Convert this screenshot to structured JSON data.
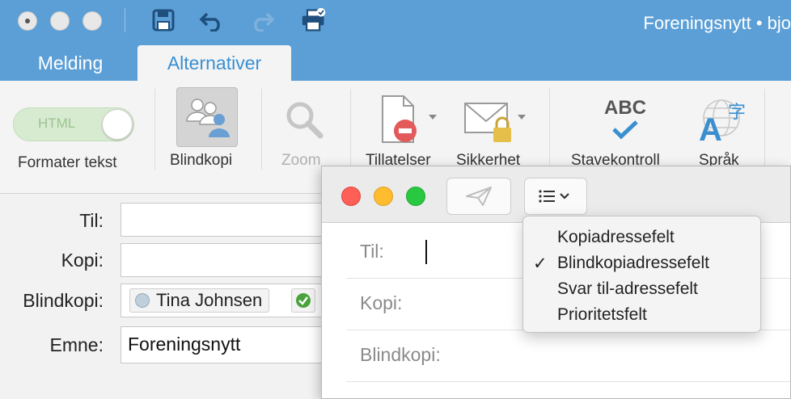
{
  "titlebar": {
    "window_title": "Foreningsnytt • bjo",
    "icons": [
      "close-dot-icon",
      "save-icon",
      "undo-icon",
      "redo-icon",
      "print-icon"
    ]
  },
  "tabs": [
    {
      "label": "Melding",
      "active": false
    },
    {
      "label": "Alternativer",
      "active": true
    }
  ],
  "ribbon": {
    "format_toggle": "HTML",
    "format_label": "Formater tekst",
    "bcc_label": "Blindkopi",
    "zoom_label": "Zoom",
    "permissions_label": "Tillatelser",
    "security_label": "Sikkerhet",
    "spelling_label": "Stavekontroll",
    "spelling_icon_text": "ABC",
    "language_label": "Språk"
  },
  "form": {
    "to_label": "Til:",
    "cc_label": "Kopi:",
    "bcc_label": "Blindkopi:",
    "subject_label": "Emne:",
    "bcc_chip": "Tina Johnsen",
    "subject_value": "Foreningsnytt"
  },
  "overlay": {
    "to_label": "Til:",
    "cc_label": "Kopi:",
    "bcc_label": "Blindkopi:"
  },
  "menu": {
    "items": [
      {
        "label": "Kopiadressefelt",
        "checked": false
      },
      {
        "label": "Blindkopiadressefelt",
        "checked": true
      },
      {
        "label": "Svar til-adressefelt",
        "checked": false
      },
      {
        "label": "Prioritetsfelt",
        "checked": false
      }
    ],
    "check_mark": "✓"
  },
  "colors": {
    "titlebar_blue": "#5b9fd6",
    "active_tab_text": "#3a8fd1",
    "toggle_green": "#d7ebd0",
    "traffic_red": "#fe5f57",
    "traffic_yellow": "#febc2e",
    "traffic_green": "#28c840"
  }
}
